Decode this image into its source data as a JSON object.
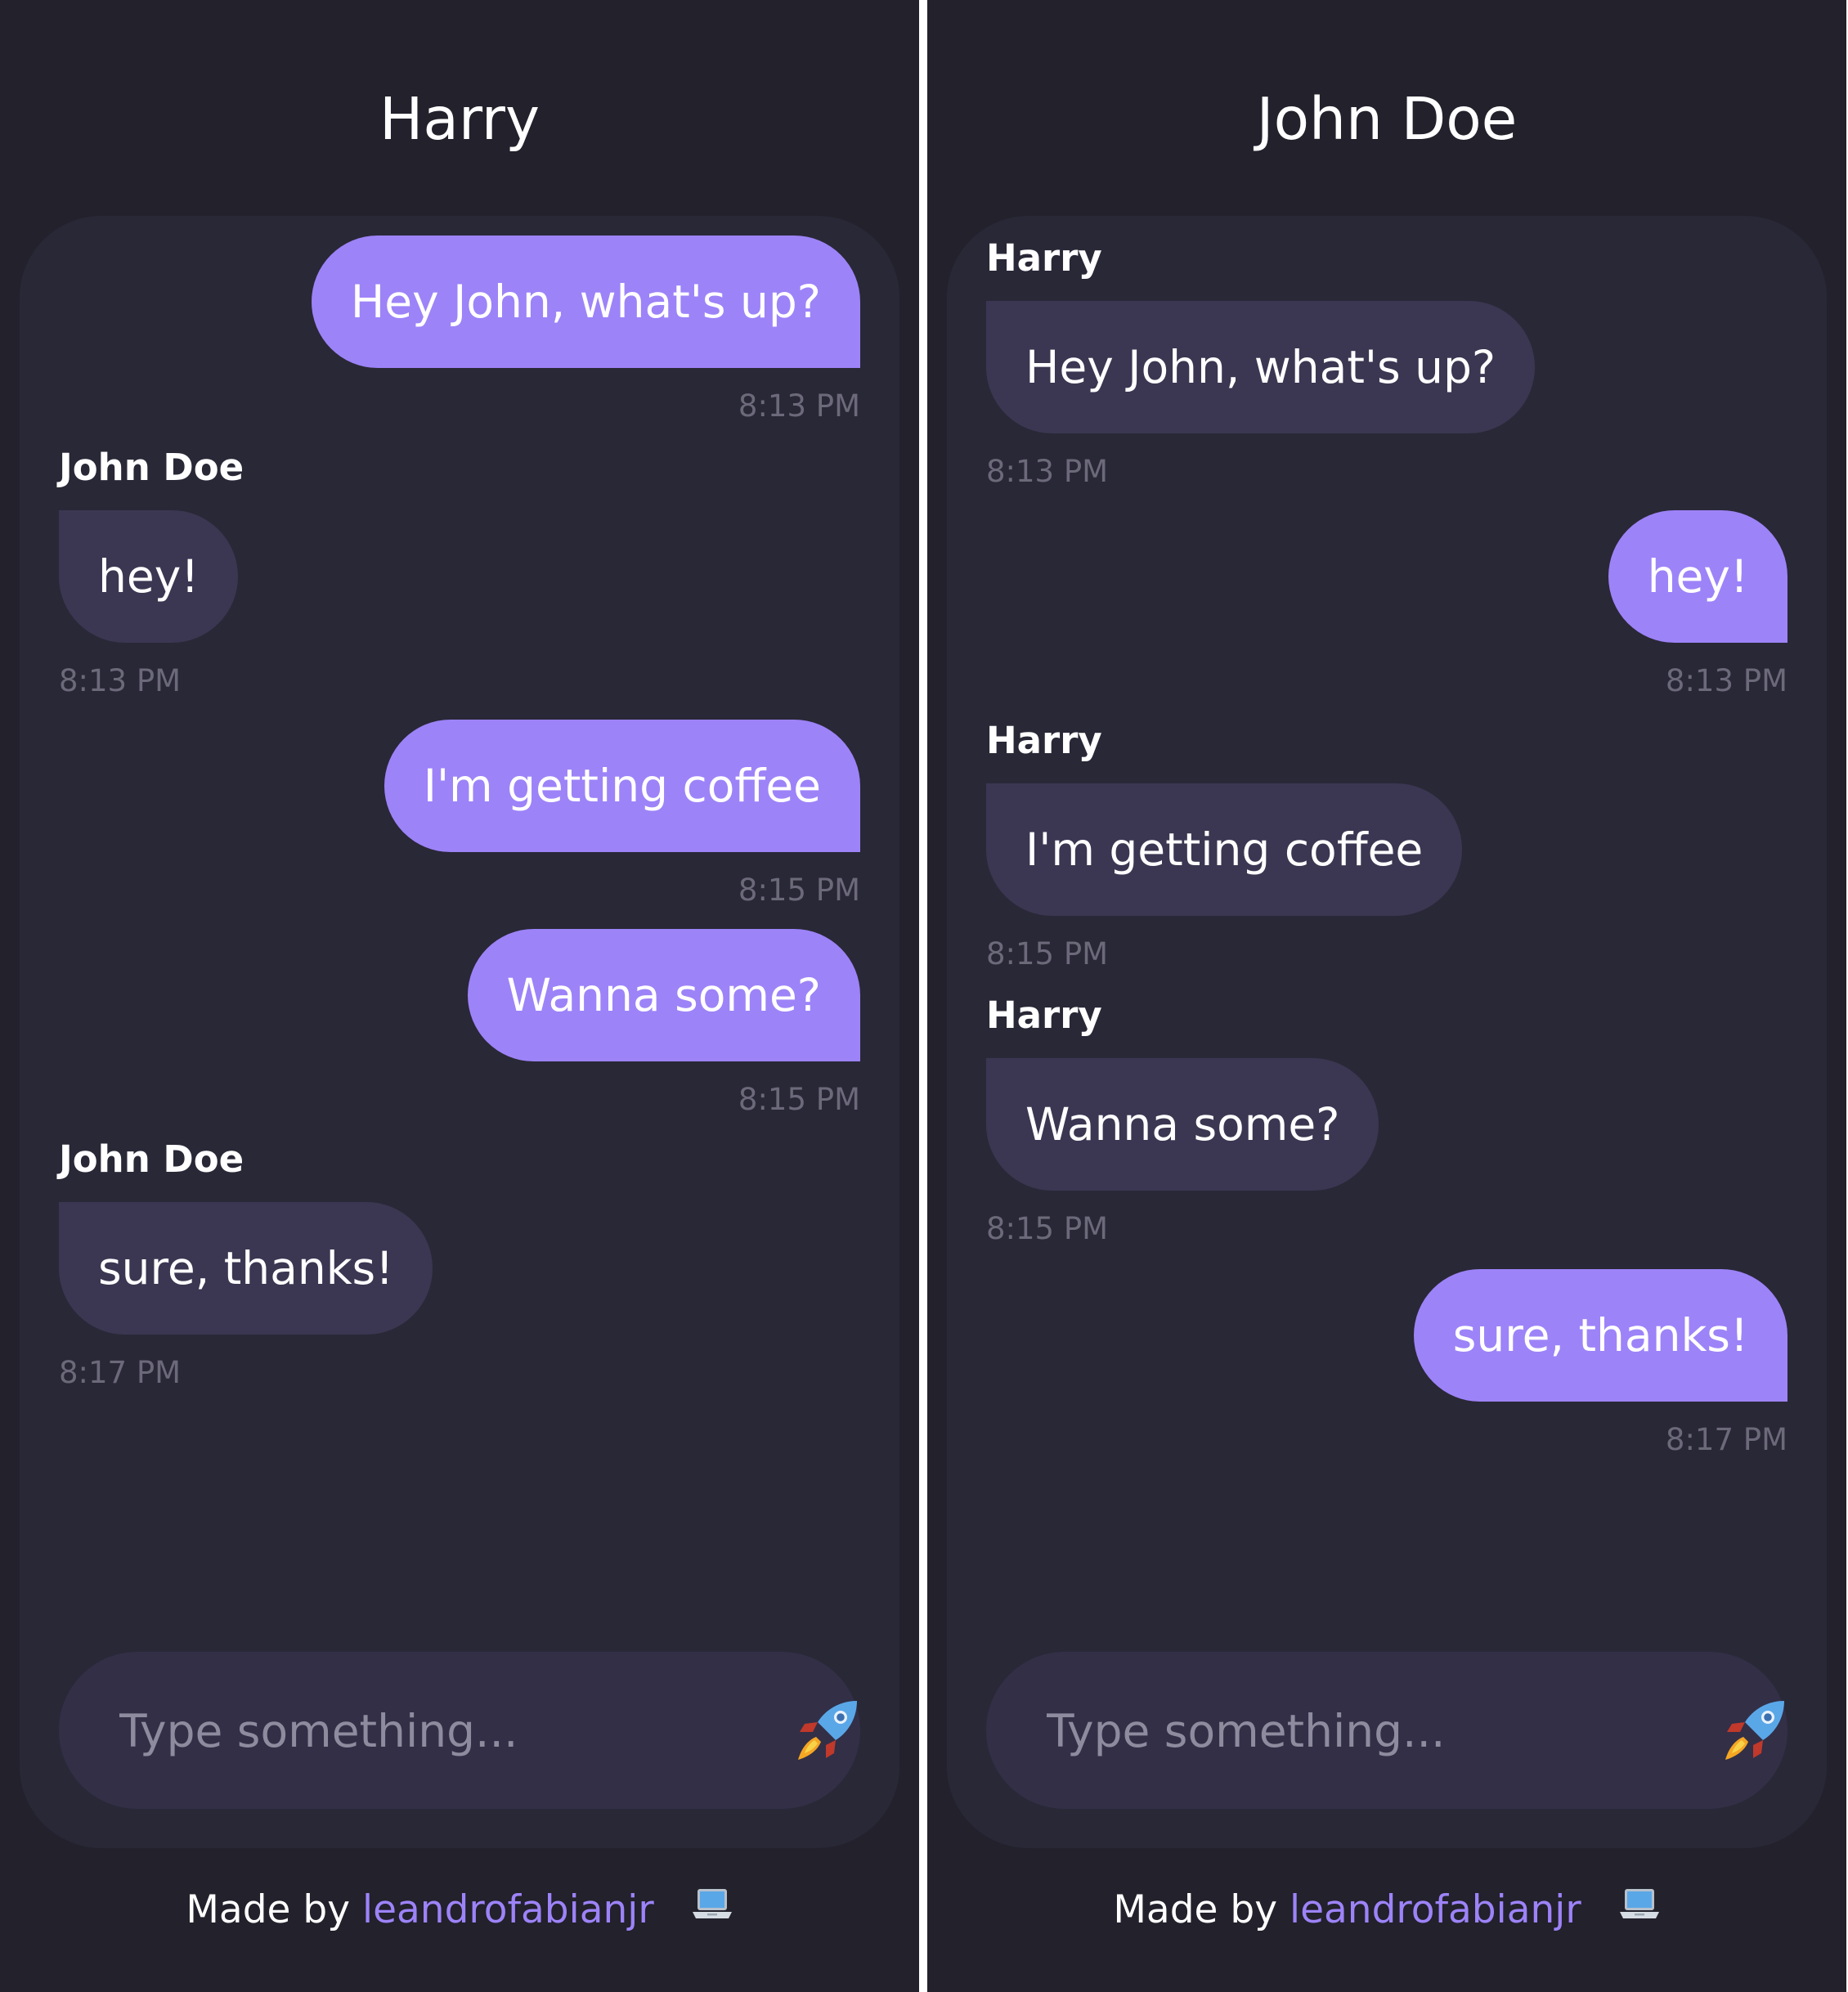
{
  "colors": {
    "background": "#22212c",
    "card": "#292837",
    "bubble_out": "#9d83f8",
    "bubble_in": "#3b3752",
    "composer": "#322f47",
    "timestamp": "#6c6a7a",
    "link": "#9d83f8"
  },
  "left": {
    "title": "Harry",
    "messages": [
      {
        "direction": "out",
        "text": "Hey John, what's up?",
        "time": "8:13 PM"
      },
      {
        "direction": "in",
        "sender": "John Doe",
        "text": "hey!",
        "time": "8:13 PM"
      },
      {
        "direction": "out",
        "text": "I'm getting coffee",
        "time": "8:15 PM"
      },
      {
        "direction": "out",
        "text": "Wanna some?",
        "time": "8:15 PM"
      },
      {
        "direction": "in",
        "sender": "John Doe",
        "text": "sure, thanks!",
        "time": "8:17 PM"
      }
    ],
    "composer": {
      "placeholder": "Type something...",
      "send_icon": "rocket-icon"
    },
    "footer": {
      "prefix": "Made by",
      "link": "leandrofabianjr",
      "icon": "laptop-icon"
    }
  },
  "right": {
    "title": "John Doe",
    "messages": [
      {
        "direction": "in",
        "sender": "Harry",
        "text": "Hey John, what's up?",
        "time": "8:13 PM"
      },
      {
        "direction": "out",
        "text": "hey!",
        "time": "8:13 PM"
      },
      {
        "direction": "in",
        "sender": "Harry",
        "text": "I'm getting coffee",
        "time": "8:15 PM"
      },
      {
        "direction": "in",
        "sender": "Harry",
        "text": "Wanna some?",
        "time": "8:15 PM"
      },
      {
        "direction": "out",
        "text": "sure, thanks!",
        "time": "8:17 PM"
      }
    ],
    "composer": {
      "placeholder": "Type something...",
      "send_icon": "rocket-icon"
    },
    "footer": {
      "prefix": "Made by",
      "link": "leandrofabianjr",
      "icon": "laptop-icon"
    }
  }
}
